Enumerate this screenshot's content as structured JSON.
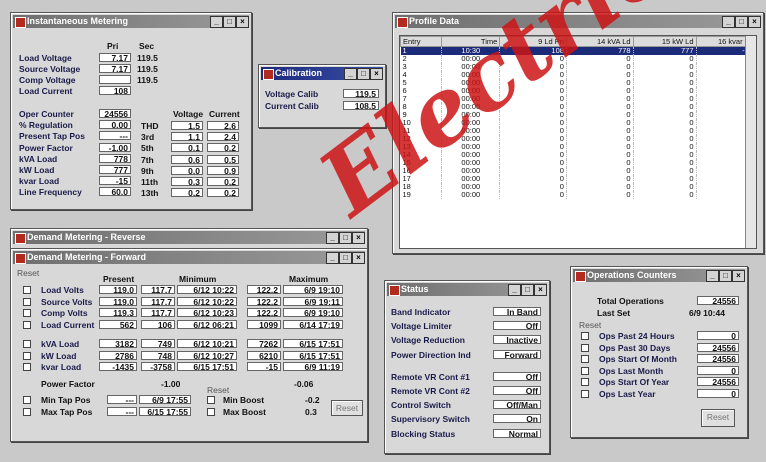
{
  "instantaneous": {
    "title": "Instantaneous Metering",
    "col_pri": "Pri",
    "col_sec": "Sec",
    "rows": [
      {
        "label": "Load Voltage",
        "pri": "7.17",
        "sec": "119.5"
      },
      {
        "label": "Source Voltage",
        "pri": "7.17",
        "sec": "119.5"
      },
      {
        "label": "Comp Voltage",
        "pri": "",
        "sec": "119.5"
      },
      {
        "label": "Load Current",
        "pri": "108",
        "sec": ""
      }
    ],
    "rows2": [
      {
        "label": "Oper Counter",
        "value": "24556"
      },
      {
        "label": "% Regulation",
        "value": "0.00"
      },
      {
        "label": "Present Tap Pos",
        "value": "---"
      },
      {
        "label": "Power Factor",
        "value": "-1.00"
      },
      {
        "label": "kVA Load",
        "value": "778"
      },
      {
        "label": "kW Load",
        "value": "777"
      },
      {
        "label": "kvar Load",
        "value": "-15"
      },
      {
        "label": "Line Frequency",
        "value": "60.0"
      }
    ],
    "harm_head_v": "Voltage",
    "harm_head_c": "Current",
    "harmonics": [
      {
        "label": "THD",
        "v": "1.5",
        "c": "2.6"
      },
      {
        "label": "3rd",
        "v": "1.1",
        "c": "2.4"
      },
      {
        "label": "5th",
        "v": "0.1",
        "c": "0.2"
      },
      {
        "label": "7th",
        "v": "0.6",
        "c": "0.5"
      },
      {
        "label": "9th",
        "v": "0.0",
        "c": "0.9"
      },
      {
        "label": "11th",
        "v": "0.3",
        "c": "0.2"
      },
      {
        "label": "13th",
        "v": "0.2",
        "c": "0.2"
      }
    ]
  },
  "calibration": {
    "title": "Calibration",
    "rows": [
      {
        "label": "Voltage Calib",
        "value": "119.5"
      },
      {
        "label": "Current Calib",
        "value": "108.5"
      }
    ]
  },
  "profile": {
    "title": "Profile Data",
    "headers": [
      "Entry",
      "Time",
      "9 Ld Pri",
      "14 kVA Ld",
      "15 kW Ld",
      "16 kvar Ld"
    ],
    "rows": [
      [
        "1",
        "10:30",
        "108",
        "778",
        "777",
        "-15"
      ],
      [
        "2",
        "00:00",
        "0",
        "0",
        "0",
        "0"
      ],
      [
        "3",
        "00:00",
        "0",
        "0",
        "0",
        "0"
      ],
      [
        "4",
        "00:00",
        "0",
        "0",
        "0",
        "0"
      ],
      [
        "5",
        "00:00",
        "0",
        "0",
        "0",
        "0"
      ],
      [
        "6",
        "00:00",
        "0",
        "0",
        "0",
        "0"
      ],
      [
        "7",
        "00:00",
        "0",
        "0",
        "0",
        "0"
      ],
      [
        "8",
        "00:00",
        "0",
        "0",
        "0",
        "0"
      ],
      [
        "9",
        "00:00",
        "0",
        "0",
        "0",
        "0"
      ],
      [
        "10",
        "00:00",
        "0",
        "0",
        "0",
        "0"
      ],
      [
        "11",
        "00:00",
        "0",
        "0",
        "0",
        "0"
      ],
      [
        "12",
        "00:00",
        "0",
        "0",
        "0",
        "0"
      ],
      [
        "13",
        "00:00",
        "0",
        "0",
        "0",
        "0"
      ],
      [
        "14",
        "00:00",
        "0",
        "0",
        "0",
        "0"
      ],
      [
        "15",
        "00:00",
        "0",
        "0",
        "0",
        "0"
      ],
      [
        "16",
        "00:00",
        "0",
        "0",
        "0",
        "0"
      ],
      [
        "17",
        "00:00",
        "0",
        "0",
        "0",
        "0"
      ],
      [
        "18",
        "00:00",
        "0",
        "0",
        "0",
        "0"
      ],
      [
        "19",
        "00:00",
        "0",
        "0",
        "0",
        "0"
      ]
    ]
  },
  "demand_reverse": {
    "title": "Demand Metering - Reverse"
  },
  "demand_forward": {
    "title": "Demand Metering - Forward",
    "reset": "Reset",
    "h_present": "Present",
    "h_min": "Minimum",
    "h_max": "Maximum",
    "rows": [
      {
        "label": "Load Volts",
        "present": "119.0",
        "min": "117.7",
        "min_t": "6/12 10:22",
        "max": "122.2",
        "max_t": "6/9 19:10"
      },
      {
        "label": "Source Volts",
        "present": "119.0",
        "min": "117.7",
        "min_t": "6/12 10:22",
        "max": "122.2",
        "max_t": "6/9 19:11"
      },
      {
        "label": "Comp Volts",
        "present": "119.3",
        "min": "117.7",
        "min_t": "6/12 10:23",
        "max": "122.2",
        "max_t": "6/9 19:10"
      },
      {
        "label": "Load Current",
        "present": "562",
        "min": "106",
        "min_t": "6/12 06:21",
        "max": "1099",
        "max_t": "6/14 17:19"
      },
      {
        "label": "kVA Load",
        "present": "3182",
        "min": "749",
        "min_t": "6/12 10:21",
        "max": "7262",
        "max_t": "6/15 17:51"
      },
      {
        "label": "kW Load",
        "present": "2786",
        "min": "748",
        "min_t": "6/12 10:27",
        "max": "6210",
        "max_t": "6/15 17:51"
      },
      {
        "label": "kvar Load",
        "present": "-1435",
        "min": "-3758",
        "min_t": "6/15 17:51",
        "max": "-15",
        "max_t": "6/9 11:19"
      }
    ],
    "pf_label": "Power Factor",
    "pf_min": "-1.00",
    "pf_max": "-0.06",
    "min_tap_label": "Min Tap Pos",
    "min_tap_val": "---",
    "min_tap_t": "6/9 17:55",
    "max_tap_label": "Max Tap Pos",
    "max_tap_val": "---",
    "max_tap_t": "6/15 17:55",
    "boost_reset": "Reset",
    "min_boost_label": "Min Boost",
    "min_boost_val": "-0.2",
    "max_boost_label": "Max Boost",
    "max_boost_val": "0.3",
    "reset_button": "Reset"
  },
  "status": {
    "title": "Status",
    "rows": [
      {
        "label": "Band Indicator",
        "value": "In Band"
      },
      {
        "label": "Voltage Limiter",
        "value": "Off"
      },
      {
        "label": "Voltage Reduction",
        "value": "Inactive"
      },
      {
        "label": "Power Direction Ind",
        "value": "Forward"
      },
      {
        "label": "Remote VR Cont #1",
        "value": "Off"
      },
      {
        "label": "Remote VR Cont #2",
        "value": "Off"
      },
      {
        "label": "Control Switch",
        "value": "Off/Man"
      },
      {
        "label": "Supervisory Switch",
        "value": "On"
      },
      {
        "label": "Blocking Status",
        "value": "Normal"
      }
    ]
  },
  "operations": {
    "title": "Operations Counters",
    "total_label": "Total Operations",
    "total_value": "24556",
    "last_set_label": "Last Set",
    "last_set_value": "6/9 10:44",
    "reset": "Reset",
    "rows": [
      {
        "label": "Ops Past 24 Hours",
        "value": "0"
      },
      {
        "label": "Ops Past 30 Days",
        "value": "24556"
      },
      {
        "label": "Ops Start Of Month",
        "value": "24556"
      },
      {
        "label": "Ops Last Month",
        "value": "0"
      },
      {
        "label": "Ops Start Of Year",
        "value": "24556"
      },
      {
        "label": "Ops Last Year",
        "value": "0"
      }
    ],
    "reset_button": "Reset"
  },
  "watermark": "Electrical"
}
